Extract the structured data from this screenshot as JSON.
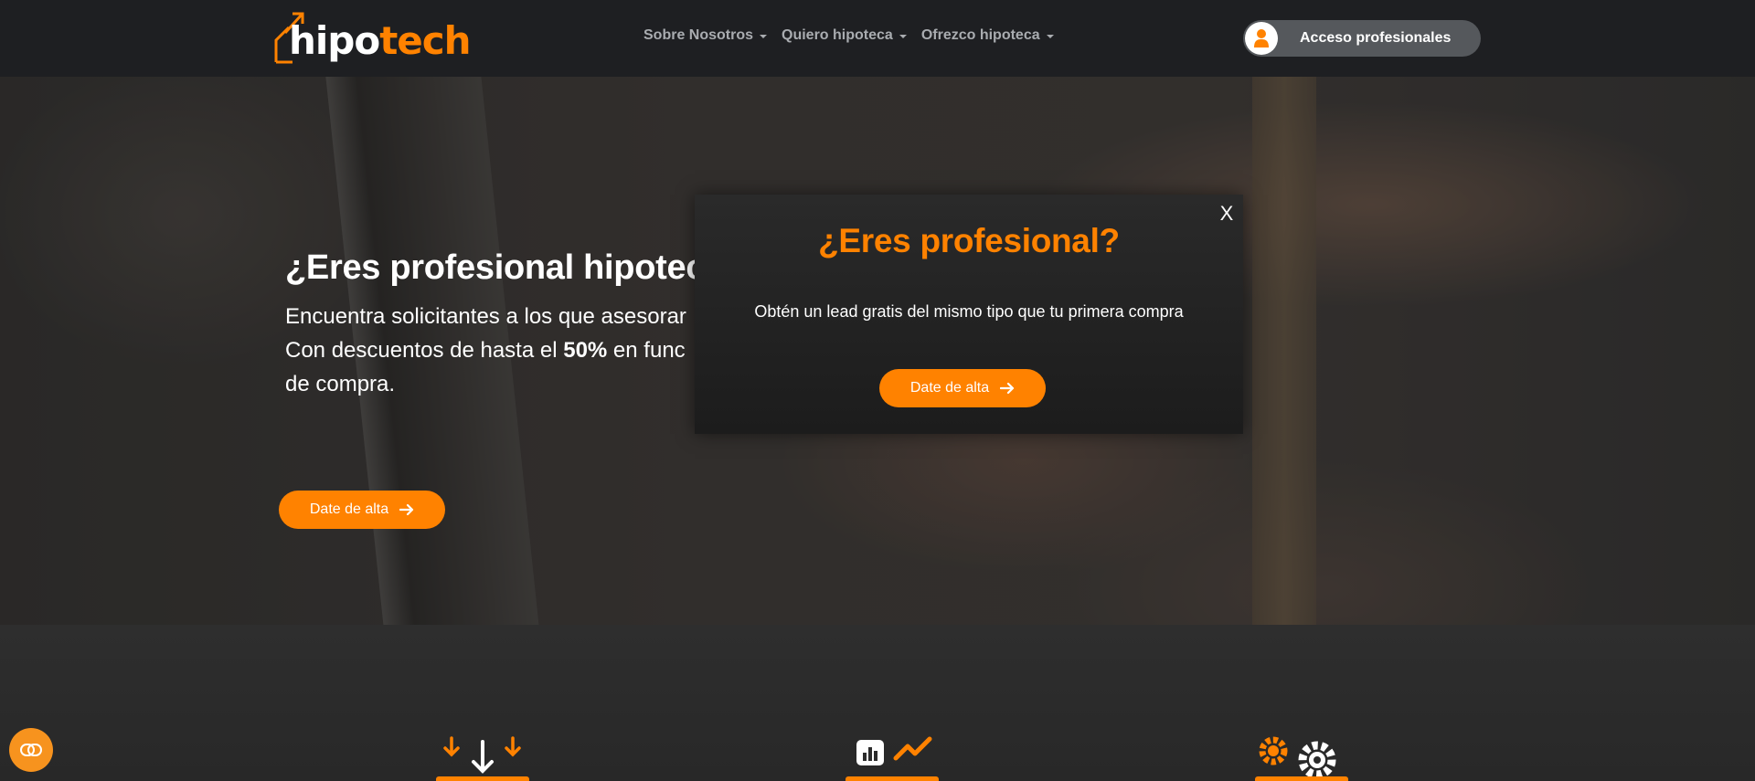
{
  "brand": {
    "logo_left": "hipo",
    "logo_right": "tech",
    "accent": "#ff8200"
  },
  "nav": {
    "items": [
      {
        "label": "Sobre Nosotros"
      },
      {
        "label": "Quiero hipoteca"
      },
      {
        "label": "Ofrezco hipoteca"
      }
    ],
    "access_label": "Acceso profesionales"
  },
  "hero": {
    "title": "¿Eres profesional hipotec",
    "line1": "Encuentra solicitantes a los que asesorar",
    "line2_pre": "Con descuentos de hasta el ",
    "line2_bold": "50%",
    "line2_post": " en func",
    "line3": "de compra.",
    "button_label": "Date de alta"
  },
  "modal": {
    "close_label": "X",
    "title": "¿Eres profesional?",
    "text": "Obtén un lead gratis del mismo tipo que tu primera compra",
    "button_label": "Date de alta"
  },
  "icons": {
    "logo": "house-arrow-icon",
    "user": "user-icon",
    "arrow": "arrow-right-icon",
    "feature1": "download-arrows-icon",
    "feature2": "chart-growth-icon",
    "feature3": "gears-icon",
    "chat": "chat-icon"
  }
}
